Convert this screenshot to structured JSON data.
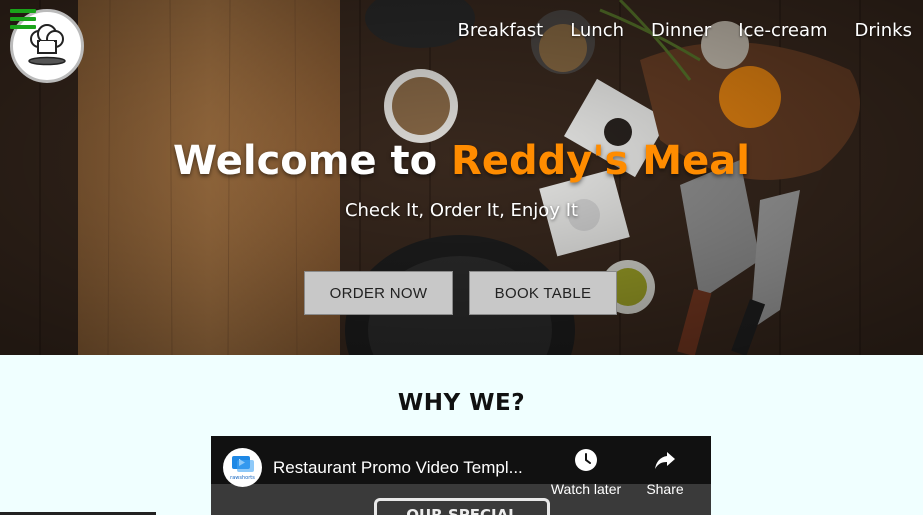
{
  "nav": {
    "menu_icon": "hamburger-menu-icon",
    "logo_icon": "chef-hat-logo",
    "items": [
      "Breakfast",
      "Lunch",
      "Dinner",
      "Ice-cream",
      "Drinks"
    ]
  },
  "hero": {
    "title_prefix": "Welcome to ",
    "title_accent": "Reddy's Meal",
    "subtitle": "Check It, Order It, Enjoy It",
    "order_button": "ORDER NOW",
    "book_button": "BOOK TABLE"
  },
  "section": {
    "heading": "WHY WE?"
  },
  "video": {
    "channel_icon": "rawshorts-channel-icon",
    "channel_label": "rawshorts",
    "title": "Restaurant Promo Video Templ...",
    "watch_later": "Watch later",
    "share": "Share",
    "thumbnail_text": "OUR SPECIAL"
  },
  "colors": {
    "accent": "#ff8c00",
    "menu_icon": "#1aa31a",
    "section_bg": "#f0ffff",
    "button_bg": "#c8c8c8"
  }
}
